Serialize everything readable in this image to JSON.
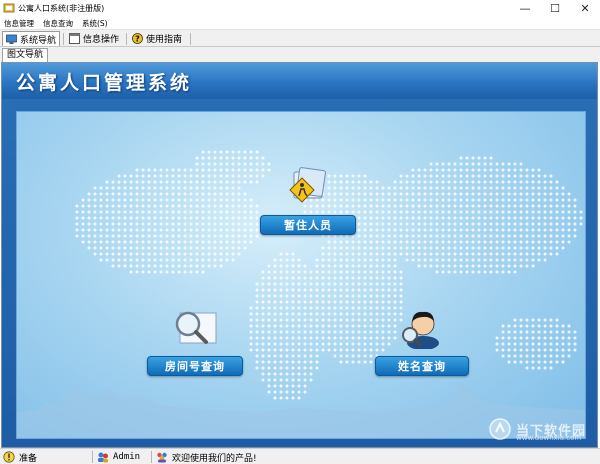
{
  "window": {
    "title": "公寓人口系统(非注册版)",
    "minimize_glyph": "—",
    "maximize_glyph": "☐",
    "close_glyph": "✕"
  },
  "menu": [
    "信息管理",
    "信息查询",
    "系统(S)"
  ],
  "tabs": [
    {
      "label": "系统导航",
      "icon": "monitor-icon",
      "active": true
    },
    {
      "label": "信息操作",
      "icon": "window-icon",
      "active": false
    },
    {
      "label": "使用指南",
      "icon": "help-icon",
      "active": false
    }
  ],
  "subtab": {
    "label": "图文导航"
  },
  "banner": {
    "title": "公寓人口管理系统"
  },
  "nav": {
    "temporary_residents": "暂住人员",
    "room_query": "房间号查询",
    "name_query": "姓名查询"
  },
  "status": {
    "ready": "准备",
    "user": "Admin",
    "welcome": "欢迎使用我们的产品!"
  },
  "watermark": {
    "text": "当下软件园",
    "url": "www.downxia.com"
  },
  "colors": {
    "banner": "#2a75c2",
    "nav_button": "#1a7cc9",
    "stage": "#a9d6f1"
  }
}
